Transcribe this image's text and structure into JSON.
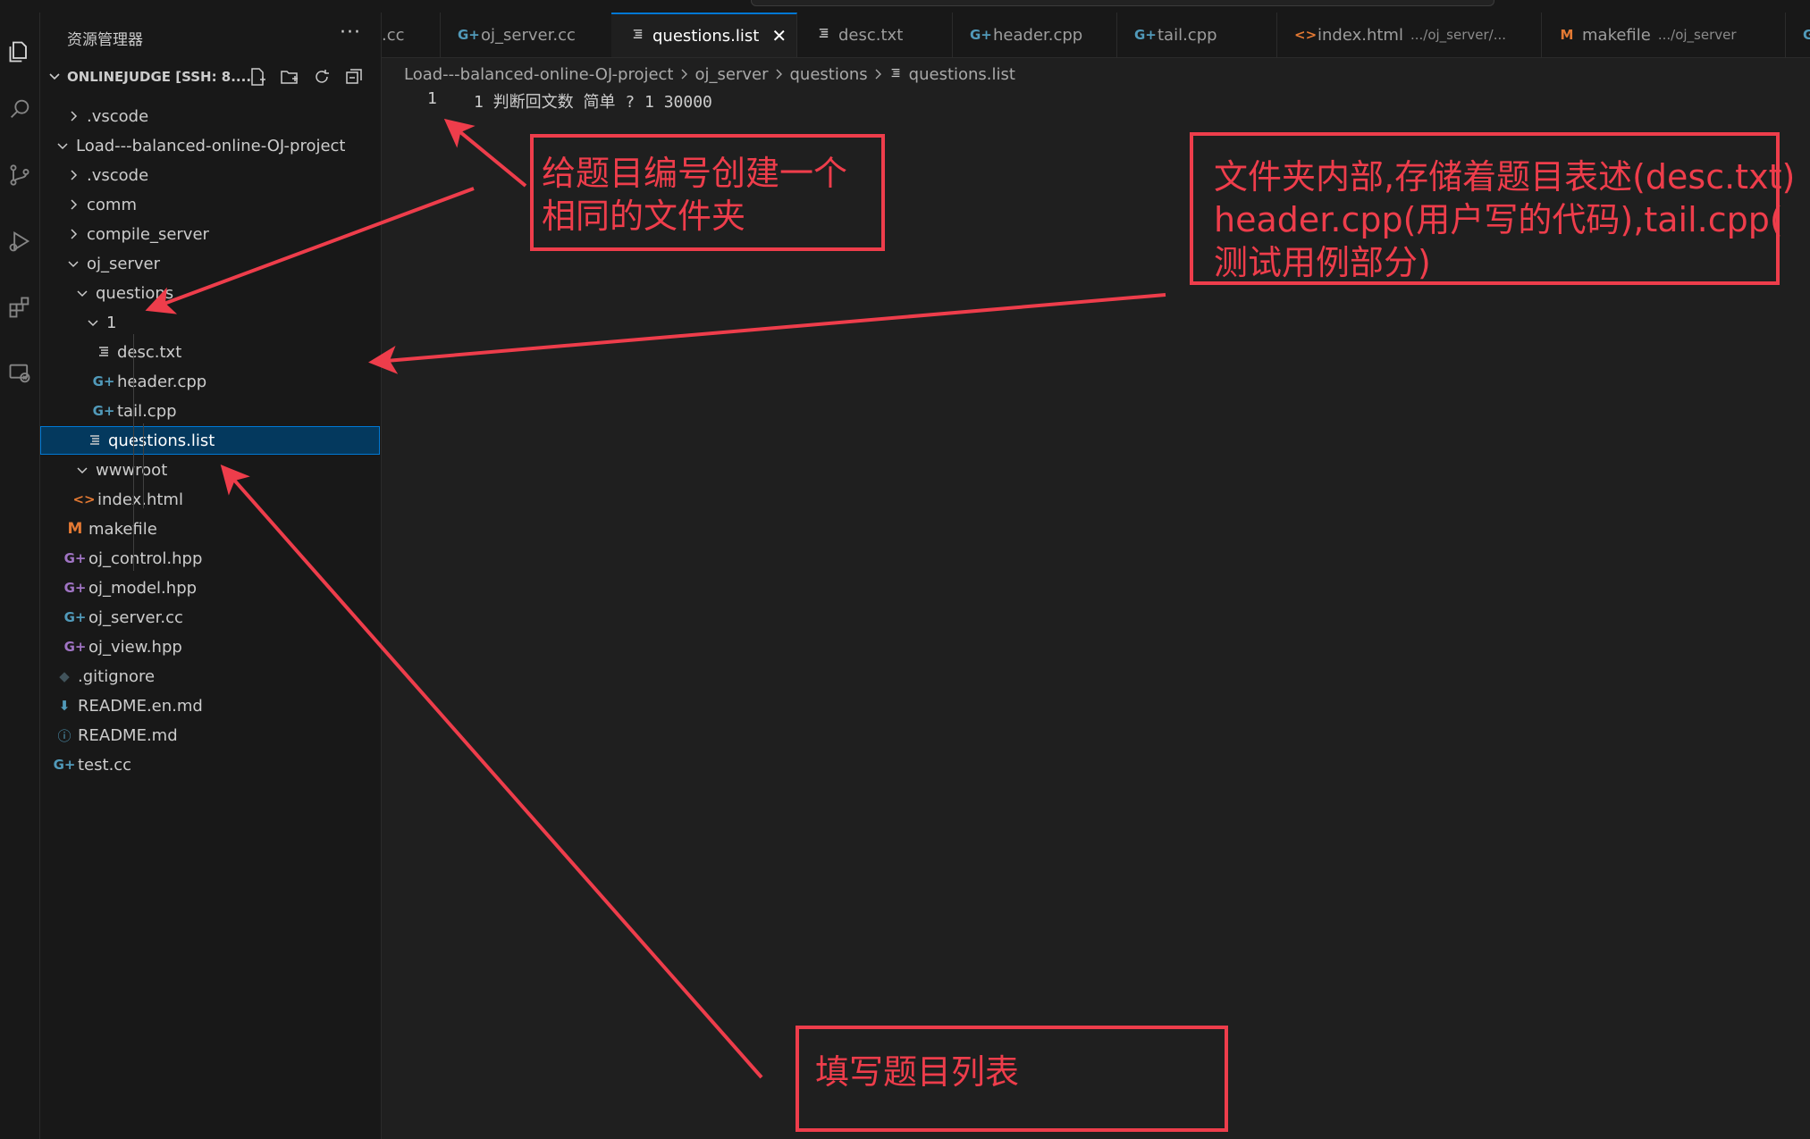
{
  "window": {
    "accent": "#0078d4",
    "annotation_color": "#ee3d4b"
  },
  "sidebar": {
    "title": "资源管理器",
    "more": "···",
    "workspace": "ONLINEJUDGE [SSH: 8....",
    "tree": [
      {
        "label": ".vscode",
        "type": "folder",
        "expanded": false
      },
      {
        "label": "Load---balanced-online-OJ-project",
        "type": "folder",
        "expanded": true
      },
      {
        "label": ".vscode",
        "type": "folder",
        "expanded": false
      },
      {
        "label": "comm",
        "type": "folder",
        "expanded": false
      },
      {
        "label": "compile_server",
        "type": "folder",
        "expanded": false
      },
      {
        "label": "oj_server",
        "type": "folder",
        "expanded": true
      },
      {
        "label": "questions",
        "type": "folder",
        "expanded": true
      },
      {
        "label": "1",
        "type": "folder",
        "expanded": true
      },
      {
        "label": "desc.txt",
        "type": "text-file"
      },
      {
        "label": "header.cpp",
        "type": "cpp-file"
      },
      {
        "label": "tail.cpp",
        "type": "cpp-file"
      },
      {
        "label": "questions.list",
        "type": "text-file",
        "selected": true
      },
      {
        "label": "wwwroot",
        "type": "folder",
        "expanded": true
      },
      {
        "label": "index.html",
        "type": "html-file"
      },
      {
        "label": "makefile",
        "type": "makefile"
      },
      {
        "label": "oj_control.hpp",
        "type": "hpp-file"
      },
      {
        "label": "oj_model.hpp",
        "type": "hpp-file"
      },
      {
        "label": "oj_server.cc",
        "type": "cpp-file"
      },
      {
        "label": "oj_view.hpp",
        "type": "hpp-file"
      },
      {
        "label": ".gitignore",
        "type": "git-file"
      },
      {
        "label": "README.en.md",
        "type": "download-file"
      },
      {
        "label": "README.md",
        "type": "info-file"
      },
      {
        "label": "test.cc",
        "type": "cpp-file"
      }
    ]
  },
  "tabs": [
    {
      "label": ".cc",
      "desc": "",
      "type": "cpp"
    },
    {
      "label": "oj_server.cc",
      "desc": "",
      "type": "cpp"
    },
    {
      "label": "questions.list",
      "desc": "",
      "type": "text",
      "active": true,
      "close": "✕"
    },
    {
      "label": "desc.txt",
      "desc": "",
      "type": "text"
    },
    {
      "label": "header.cpp",
      "desc": "",
      "type": "cpp"
    },
    {
      "label": "tail.cpp",
      "desc": "",
      "type": "cpp"
    },
    {
      "label": "index.html",
      "desc": ".../oj_server/...",
      "type": "html"
    },
    {
      "label": "makefile",
      "desc": ".../oj_server",
      "type": "make"
    },
    {
      "label": "",
      "desc": "",
      "type": "cpp"
    }
  ],
  "breadcrumb": [
    "Load---balanced-online-OJ-project",
    "oj_server",
    "questions",
    "questions.list"
  ],
  "editor": {
    "lines": [
      {
        "number": "1",
        "text": "1 判断回文数 简单 ? 1 30000"
      }
    ]
  },
  "annotations": {
    "folder_note": "给题目编号创建一个\n相同的文件夹",
    "contents_note": "文件夹内部,存储着题目表述(desc.txt)\nheader.cpp(用户写的代码),tail.cpp(\n测试用例部分)",
    "list_note": "填写题目列表"
  }
}
